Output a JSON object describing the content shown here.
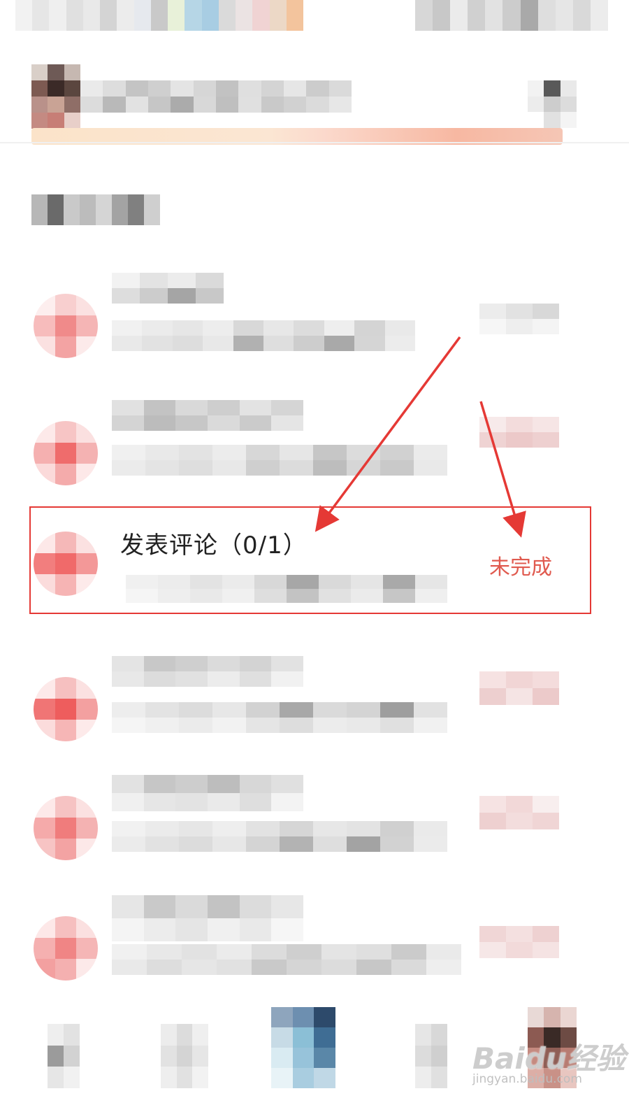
{
  "task": {
    "title": "发表评论（0/1）",
    "status": "未完成"
  },
  "watermark": {
    "brand": "Baidu经验",
    "url": "jingyan.baidu.com"
  },
  "colors": {
    "annotation": "#e53935",
    "status_text": "#e05a4f",
    "task_icon": "#f28b8b"
  }
}
